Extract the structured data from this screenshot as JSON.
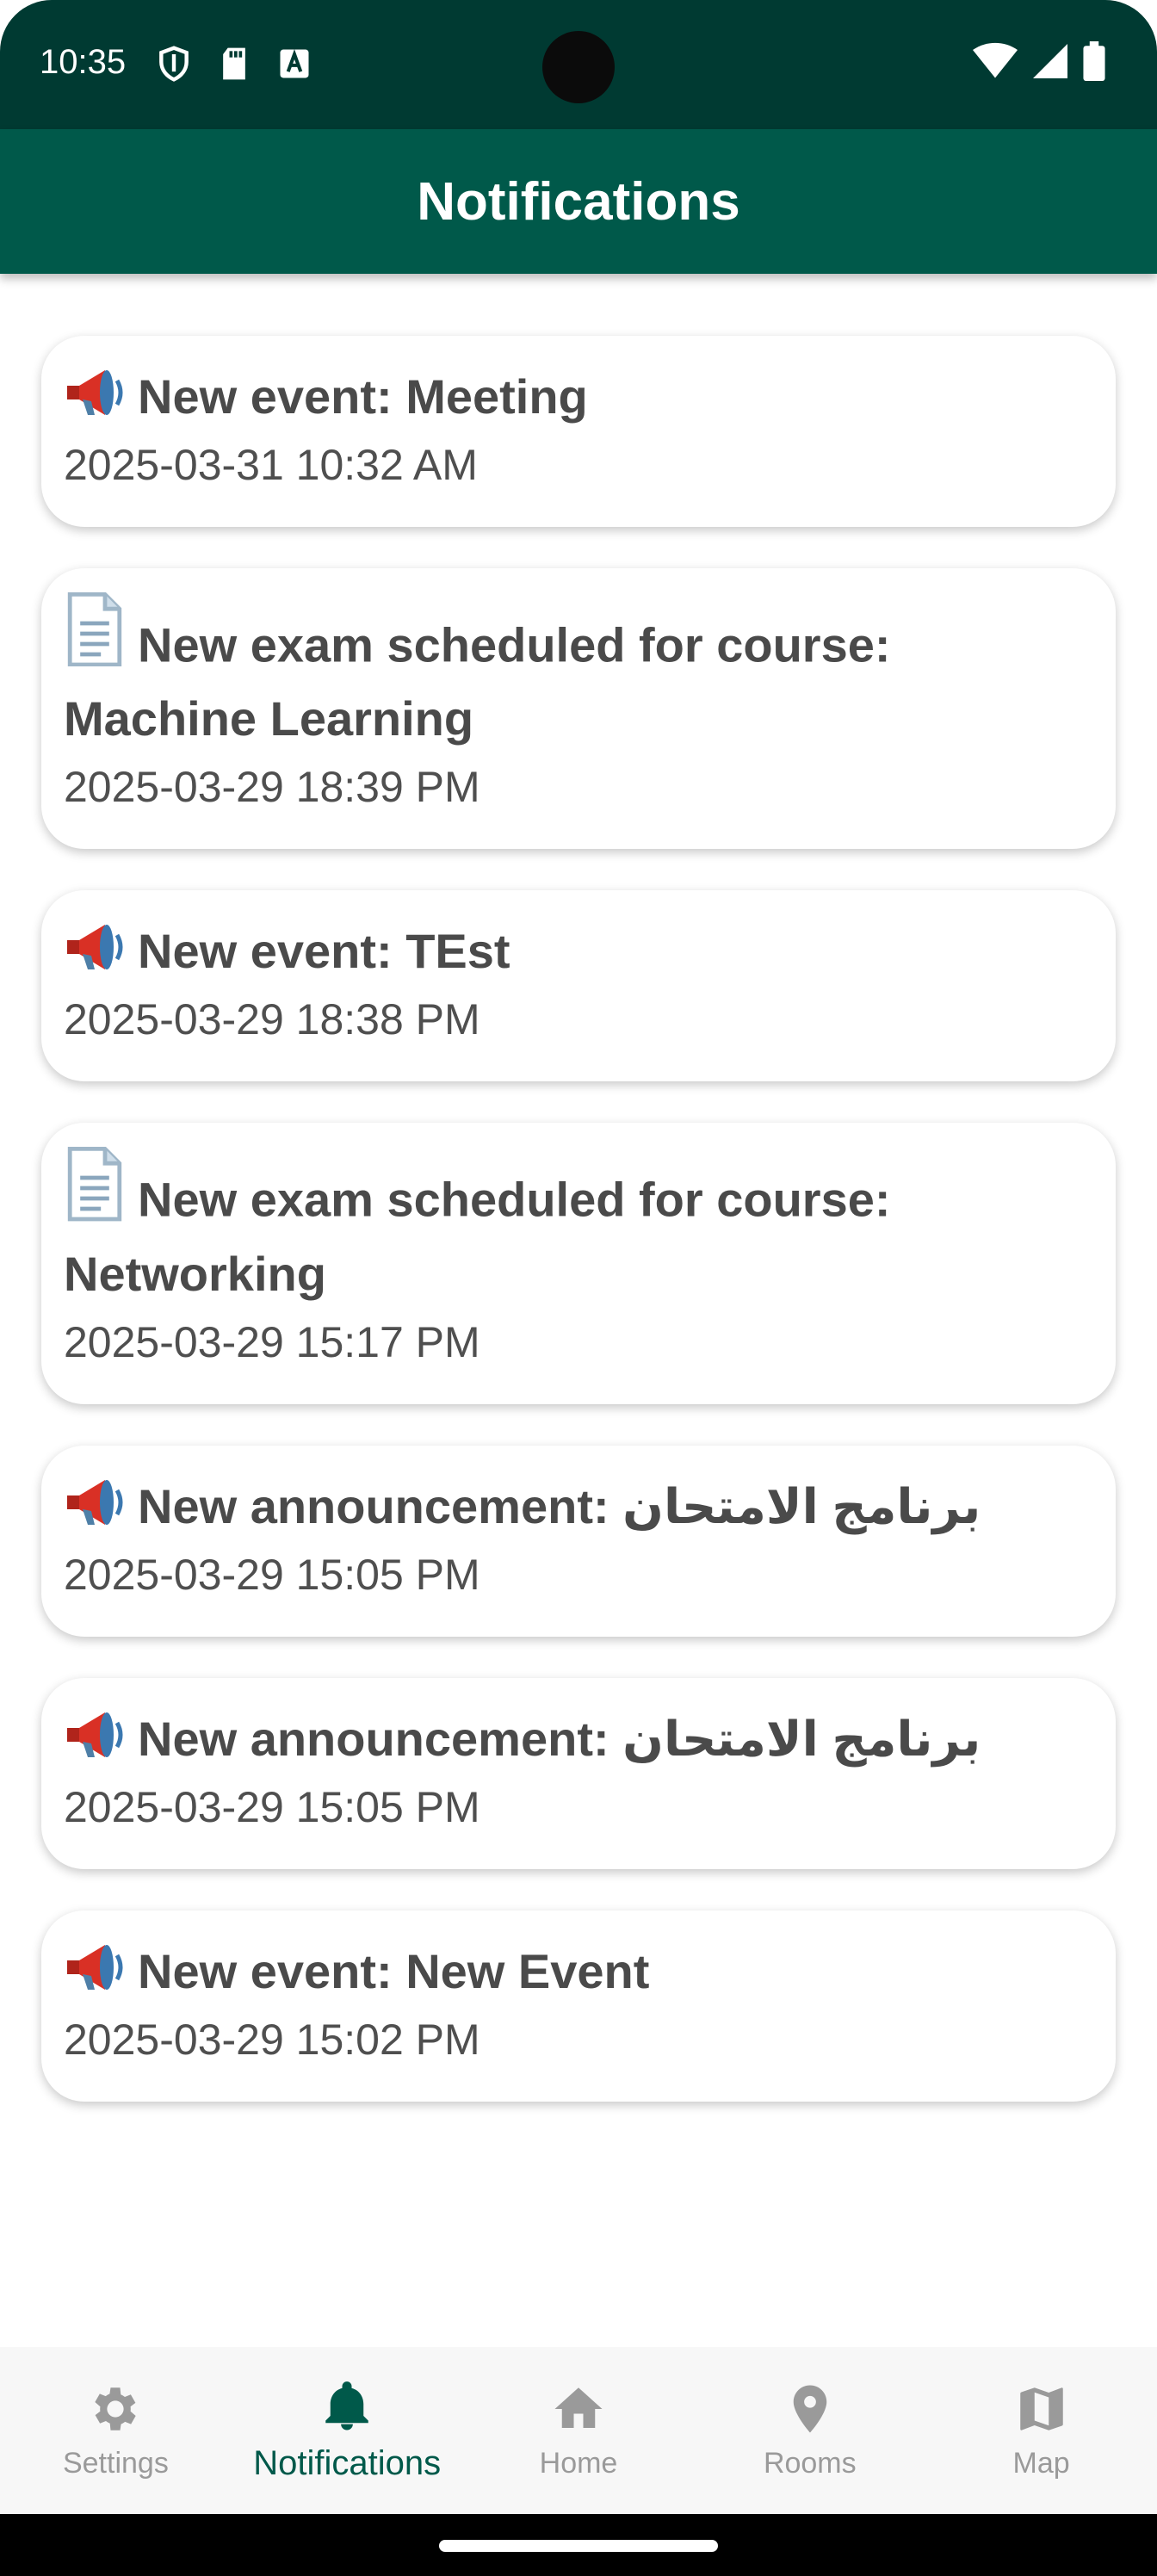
{
  "status_bar": {
    "time": "10:35"
  },
  "app_bar": {
    "title": "Notifications"
  },
  "notifications": [
    {
      "icon": "megaphone-icon",
      "title": "New event: Meeting",
      "time": "2025-03-31 10:32 AM"
    },
    {
      "icon": "document-icon",
      "title": "New exam scheduled for course: Machine Learning",
      "time": "2025-03-29 18:39 PM"
    },
    {
      "icon": "megaphone-icon",
      "title": "New event: TEst",
      "time": "2025-03-29 18:38 PM"
    },
    {
      "icon": "document-icon",
      "title": "New exam scheduled for course: Networking",
      "time": "2025-03-29 15:17 PM"
    },
    {
      "icon": "megaphone-icon",
      "title": "New announcement: برنامج الامتحان",
      "time": "2025-03-29 15:05 PM"
    },
    {
      "icon": "megaphone-icon",
      "title": "New announcement: برنامج الامتحان",
      "time": "2025-03-29 15:05 PM"
    },
    {
      "icon": "megaphone-icon",
      "title": "New event: New Event",
      "time": "2025-03-29 15:02 PM"
    }
  ],
  "bottom_nav": {
    "items": [
      {
        "label": "Settings",
        "icon": "gear-icon",
        "active": false
      },
      {
        "label": "Notifications",
        "icon": "bell-icon",
        "active": true
      },
      {
        "label": "Home",
        "icon": "home-icon",
        "active": false
      },
      {
        "label": "Rooms",
        "icon": "location-pin-icon",
        "active": false
      },
      {
        "label": "Map",
        "icon": "map-icon",
        "active": false
      }
    ]
  },
  "colors": {
    "primary": "#00594a",
    "status_bar": "#003a32",
    "inactive": "#9a9a9a"
  }
}
